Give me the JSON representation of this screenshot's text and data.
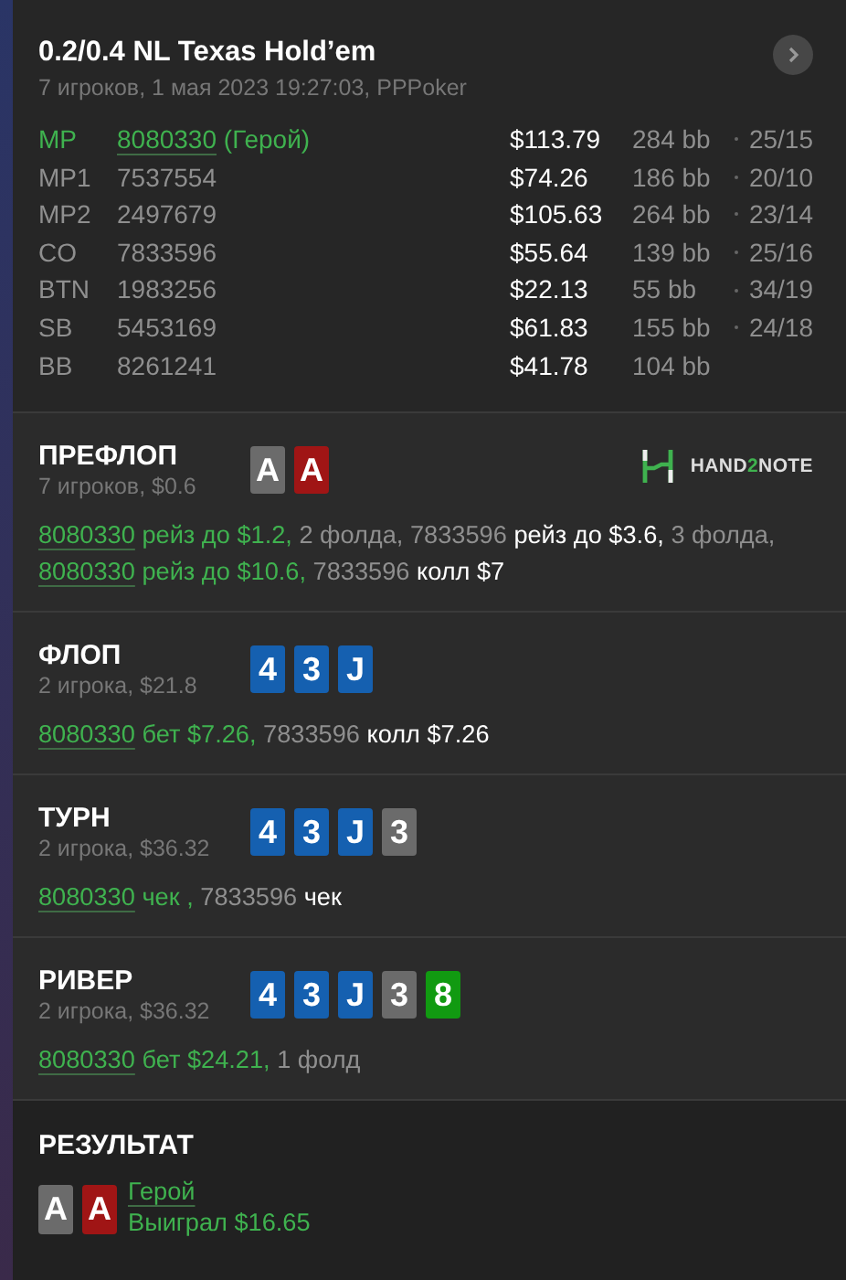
{
  "header": {
    "title": "0.2/0.4 NL Texas Hold’em",
    "subtitle": "7 игроков, 1 мая 2023 19:27:03, PPPoker"
  },
  "players": [
    {
      "position": "MP",
      "id": "8080330",
      "hero": true,
      "hero_tag": "(Герой)",
      "stack": "$113.79",
      "bb": "284 bb",
      "stats": "25/15"
    },
    {
      "position": "MP1",
      "id": "7537554",
      "hero": false,
      "stack": "$74.26",
      "bb": "186 bb",
      "stats": "20/10"
    },
    {
      "position": "MP2",
      "id": "2497679",
      "hero": false,
      "stack": "$105.63",
      "bb": "264 bb",
      "stats": "23/14"
    },
    {
      "position": "CO",
      "id": "7833596",
      "hero": false,
      "stack": "$55.64",
      "bb": "139 bb",
      "stats": "25/16"
    },
    {
      "position": "BTN",
      "id": "1983256",
      "hero": false,
      "stack": "$22.13",
      "bb": "55 bb",
      "stats": "34/19"
    },
    {
      "position": "SB",
      "id": "5453169",
      "hero": false,
      "stack": "$61.83",
      "bb": "155 bb",
      "stats": "24/18"
    },
    {
      "position": "BB",
      "id": "8261241",
      "hero": false,
      "stack": "$41.78",
      "bb": "104 bb"
    }
  ],
  "streets": [
    {
      "name": "ПРЕФЛОП",
      "info": "7 игроков, $0.6",
      "logo": [
        "HAND",
        "2",
        "NOTE"
      ],
      "cards": [
        {
          "rank": "A",
          "color": "#6b6b6b"
        },
        {
          "rank": "A",
          "color": "#a01515"
        }
      ],
      "actions": [
        {
          "kind": "hero-link",
          "text": "8080330"
        },
        {
          "kind": "hero",
          "text": "рейз до $1.2,"
        },
        {
          "kind": "player",
          "text": "2 фолда, 7833596"
        },
        {
          "kind": "action",
          "text": "рейз до $3.6,"
        },
        {
          "kind": "player",
          "text": "3 фолда,"
        },
        {
          "kind": "hero-link",
          "text": "8080330"
        },
        {
          "kind": "hero",
          "text": "рейз до $10.6,"
        },
        {
          "kind": "player",
          "text": "7833596"
        },
        {
          "kind": "action",
          "text": "колл $7"
        }
      ]
    },
    {
      "name": "ФЛОП",
      "info": "2 игрока, $21.8",
      "cards": [
        {
          "rank": "4",
          "color": "#1560b0"
        },
        {
          "rank": "3",
          "color": "#1560b0"
        },
        {
          "rank": "J",
          "color": "#1560b0"
        }
      ],
      "actions": [
        {
          "kind": "hero-link",
          "text": "8080330"
        },
        {
          "kind": "hero",
          "text": "бет $7.26,"
        },
        {
          "kind": "player",
          "text": "7833596"
        },
        {
          "kind": "action",
          "text": "колл $7.26"
        }
      ]
    },
    {
      "name": "ТУРН",
      "info": "2 игрока, $36.32",
      "cards": [
        {
          "rank": "4",
          "color": "#1560b0"
        },
        {
          "rank": "3",
          "color": "#1560b0"
        },
        {
          "rank": "J",
          "color": "#1560b0"
        },
        {
          "rank": "3",
          "color": "#6b6b6b"
        }
      ],
      "actions": [
        {
          "kind": "hero-link",
          "text": "8080330"
        },
        {
          "kind": "hero",
          "text": "чек ,"
        },
        {
          "kind": "player",
          "text": "7833596"
        },
        {
          "kind": "action",
          "text": "чек"
        }
      ]
    },
    {
      "name": "РИВЕР",
      "info": "2 игрока, $36.32",
      "cards": [
        {
          "rank": "4",
          "color": "#1560b0"
        },
        {
          "rank": "3",
          "color": "#1560b0"
        },
        {
          "rank": "J",
          "color": "#1560b0"
        },
        {
          "rank": "3",
          "color": "#6b6b6b"
        },
        {
          "rank": "8",
          "color": "#119a11"
        }
      ],
      "actions": [
        {
          "kind": "hero-link",
          "text": "8080330"
        },
        {
          "kind": "hero",
          "text": "бет $24.21,"
        },
        {
          "kind": "player",
          "text": "1 фолд"
        }
      ]
    }
  ],
  "result": {
    "title": "РЕЗУЛЬТАТ",
    "cards": [
      {
        "rank": "A",
        "color": "#6b6b6b"
      },
      {
        "rank": "A",
        "color": "#a01515"
      }
    ],
    "winner": "Герой",
    "amount": "Выиграл $16.65"
  }
}
